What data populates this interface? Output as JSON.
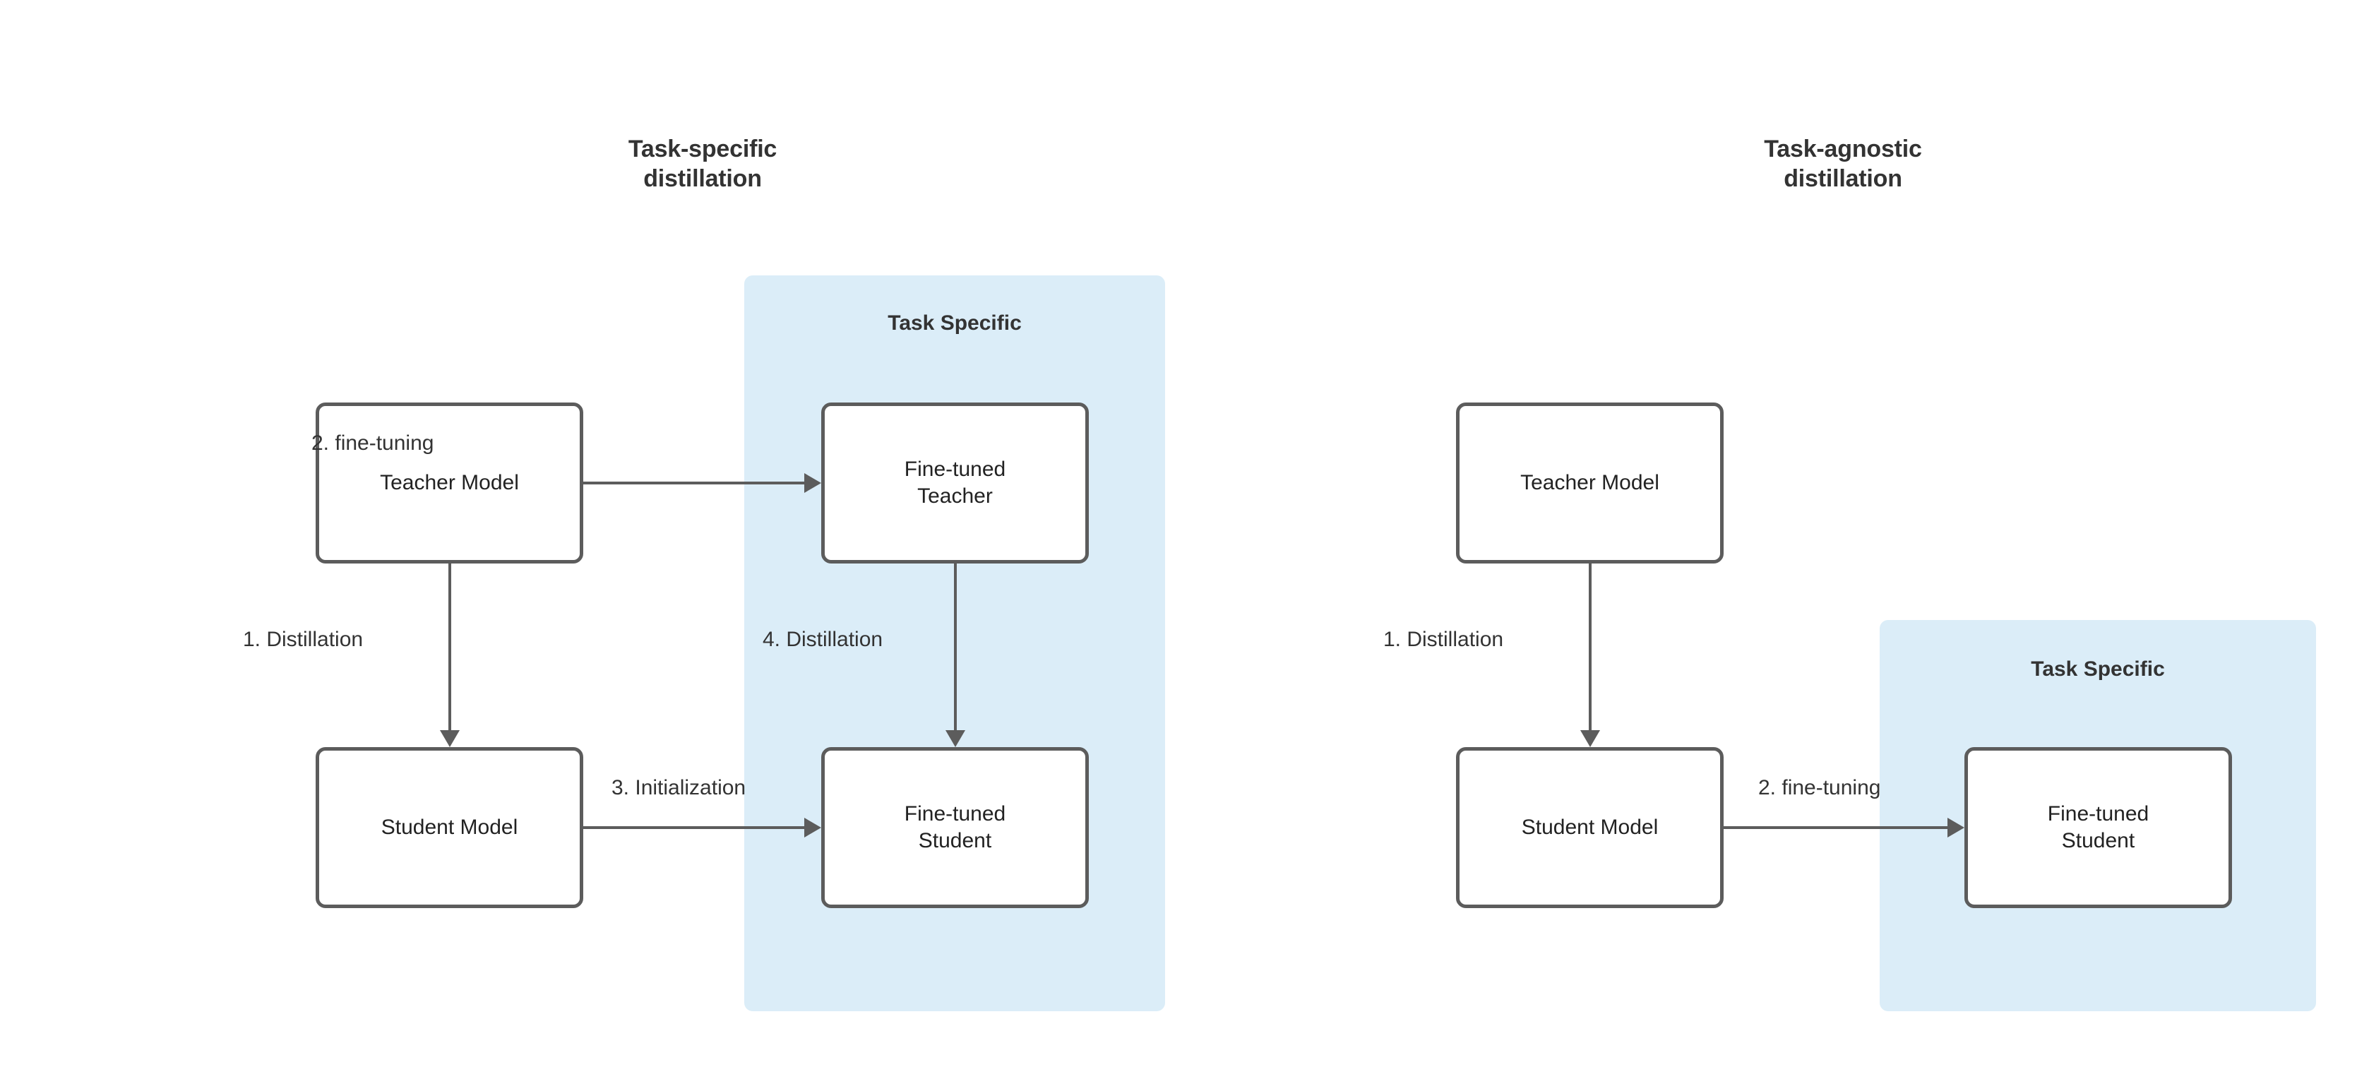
{
  "diagram": {
    "title_left": "Task-specific\ndistillation",
    "title_right": "Task-agnostic\ndistillation",
    "colors": {
      "band_fill": "#dbedf8",
      "node_stroke": "#5c5c5c",
      "text": "#333333",
      "background": "#ffffff"
    }
  },
  "left_panel": {
    "title": "Task-specific\ndistillation",
    "group_label": "Task Specific",
    "nodes": [
      {
        "id": "teacher",
        "label": "Teacher Model"
      },
      {
        "id": "ft_teacher",
        "label": "Fine-tuned\nTeacher"
      },
      {
        "id": "student",
        "label": "Student Model"
      },
      {
        "id": "ft_student",
        "label": "Fine-tuned\nStudent"
      }
    ],
    "edges": [
      {
        "id": "e1",
        "label": "1. Distillation",
        "from": "teacher",
        "to": "student"
      },
      {
        "id": "e2",
        "label": "2. fine-tuning",
        "from": "teacher",
        "to": "ft_teacher"
      },
      {
        "id": "e3",
        "label": "3. Initialization",
        "from": "student",
        "to": "ft_student"
      },
      {
        "id": "e4",
        "label": "4. Distillation",
        "from": "ft_teacher",
        "to": "ft_student"
      }
    ]
  },
  "right_panel": {
    "title": "Task-agnostic\ndistillation",
    "group_label": "Task Specific",
    "nodes": [
      {
        "id": "teacher",
        "label": "Teacher Model"
      },
      {
        "id": "student",
        "label": "Student Model"
      },
      {
        "id": "ft_student",
        "label": "Fine-tuned\nStudent"
      }
    ],
    "edges": [
      {
        "id": "e1",
        "label": "1. Distillation",
        "from": "teacher",
        "to": "student"
      },
      {
        "id": "e2",
        "label": "2. fine-tuning",
        "from": "student",
        "to": "ft_student"
      }
    ]
  }
}
